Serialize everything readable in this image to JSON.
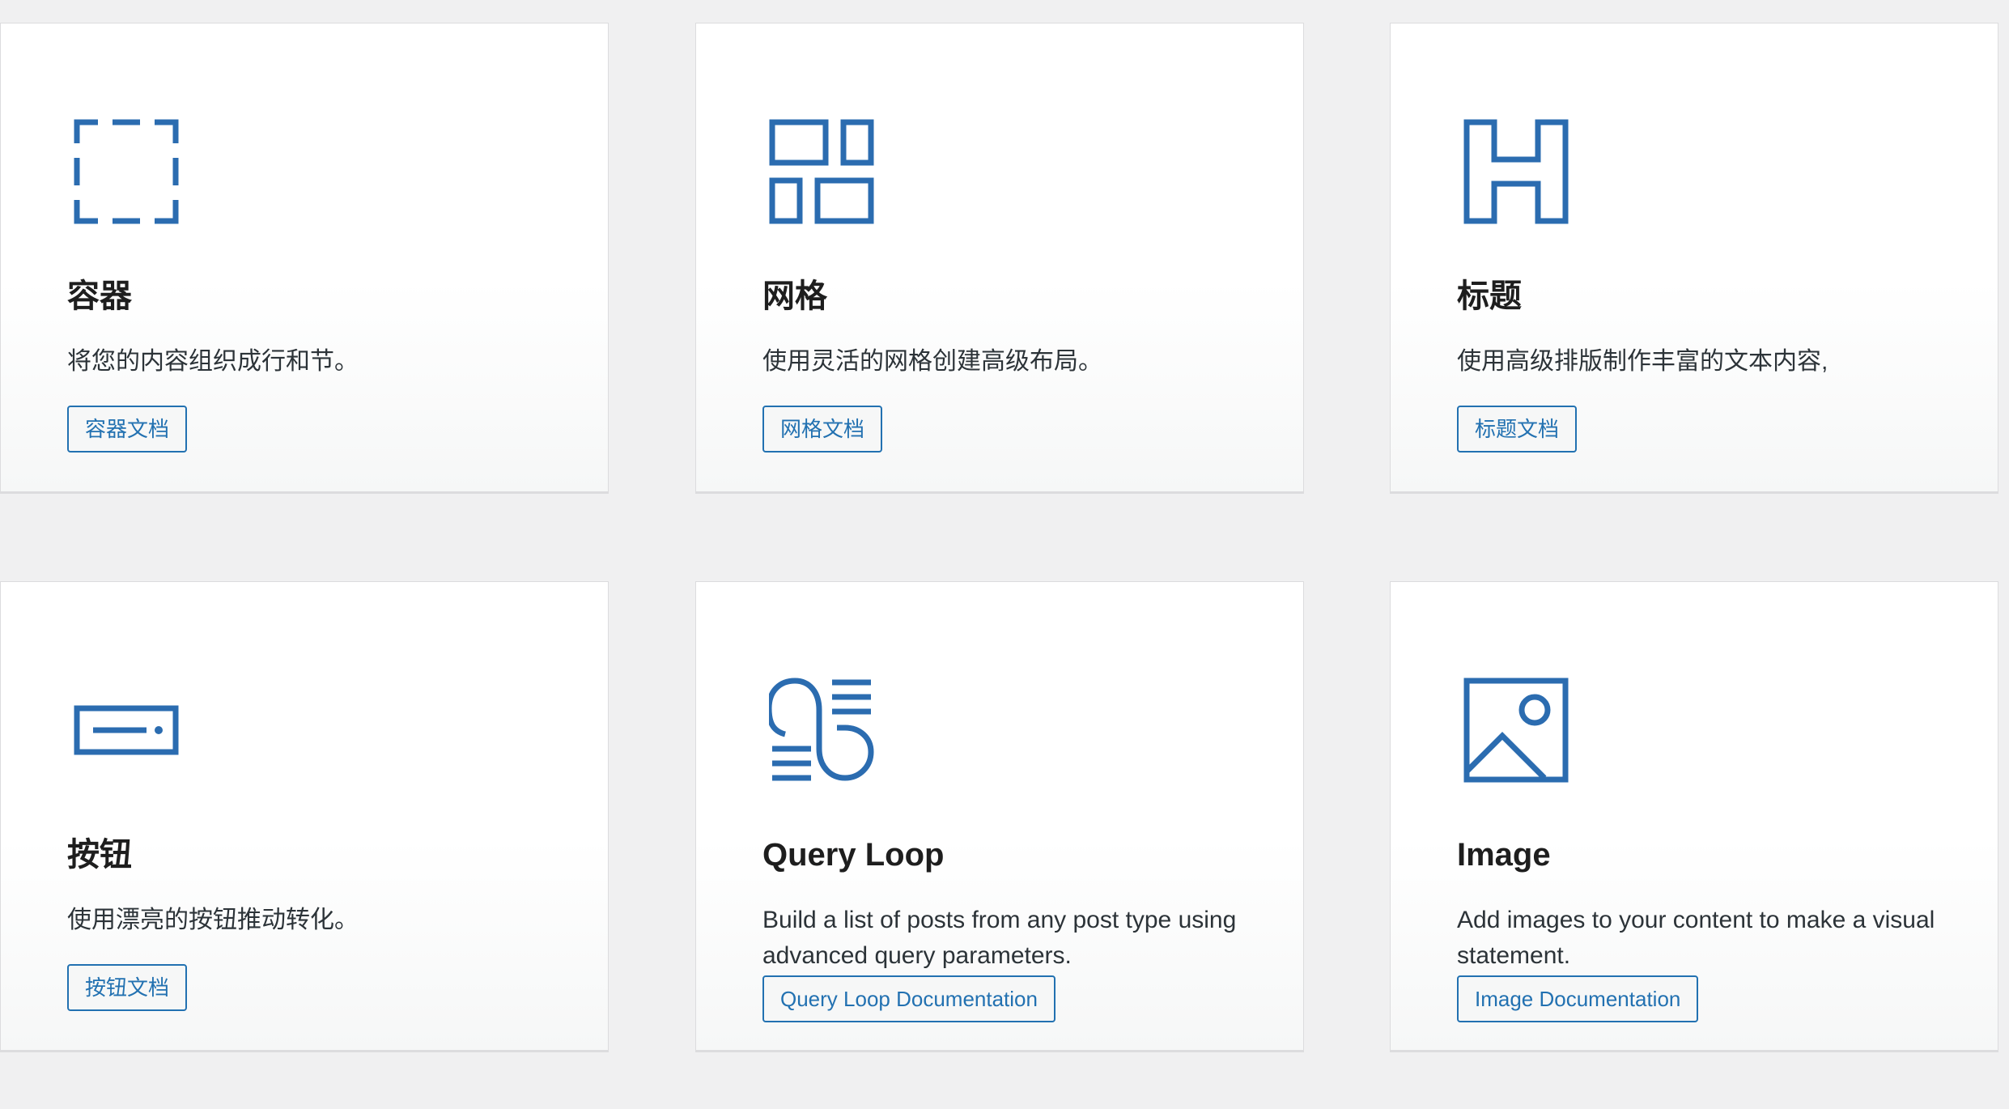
{
  "colors": {
    "background": "#f0f0f1",
    "card": "#ffffff",
    "accent": "#2271b1",
    "text": "#1e1e1e"
  },
  "cards": [
    {
      "icon": "container-dashed-square-icon",
      "title": "容器",
      "description": "将您的内容组织成行和节。",
      "button_label": "容器文档"
    },
    {
      "icon": "grid-layout-icon",
      "title": "网格",
      "description": "使用灵活的网格创建高级布局。",
      "button_label": "网格文档"
    },
    {
      "icon": "heading-h-icon",
      "title": "标题",
      "description": "使用高级排版制作丰富的文本内容,",
      "button_label": "标题文档"
    },
    {
      "icon": "button-icon",
      "title": "按钮",
      "description": "使用漂亮的按钮推动转化。",
      "button_label": "按钮文档"
    },
    {
      "icon": "query-loop-icon",
      "title": "Query Loop",
      "description": "Build a list of posts from any post type using advanced query parameters.",
      "button_label": "Query Loop Documentation"
    },
    {
      "icon": "image-icon",
      "title": "Image",
      "description": "Add images to your content to make a visual statement.",
      "button_label": "Image Documentation"
    }
  ]
}
